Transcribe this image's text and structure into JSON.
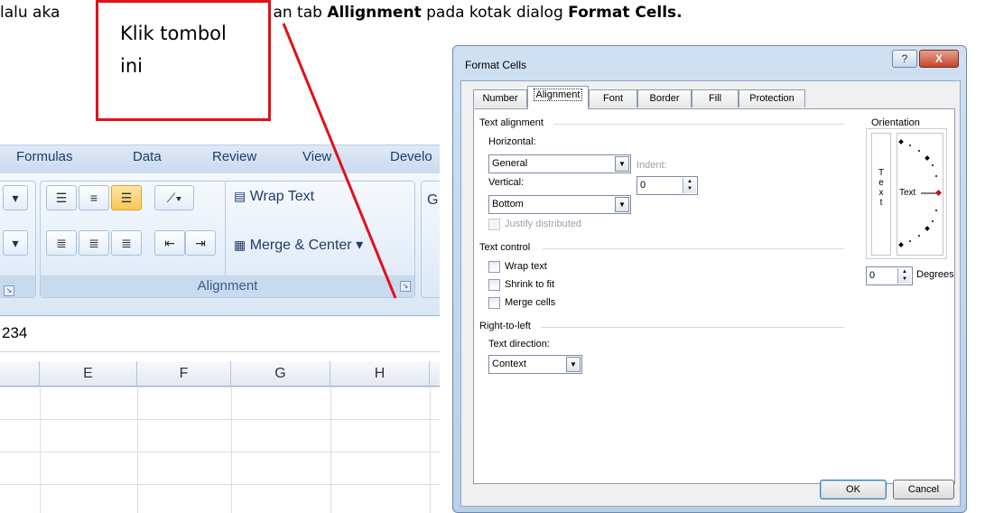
{
  "caption": {
    "prefix": "lalu aka",
    "middle": "an tab ",
    "bold1": "Allignment",
    "between": " pada kotak dialog ",
    "bold2": "Format Cells."
  },
  "callout": {
    "line1": "Klik tombol",
    "line2": "ini",
    "border_color": "#e0111a"
  },
  "excel": {
    "ribbon_tabs": [
      "Formulas",
      "Data",
      "Review",
      "View",
      "Develo"
    ],
    "wrap_text": "Wrap Text",
    "merge_center": "Merge & Center",
    "merge_dropdown": "▾",
    "group_label": "Alignment",
    "partial_g": "G",
    "formula_value": "234",
    "columns": [
      "E",
      "F",
      "G",
      "H"
    ]
  },
  "dialog": {
    "title": "Format Cells",
    "help": "?",
    "close": "X",
    "tabs": [
      "Number",
      "Alignment",
      "Font",
      "Border",
      "Fill",
      "Protection"
    ],
    "active_tab": "Alignment",
    "text_alignment": {
      "section": "Text alignment",
      "horizontal_label": "Horizontal:",
      "horizontal_value": "General",
      "vertical_label": "Vertical:",
      "vertical_value": "Bottom",
      "indent_label": "Indent:",
      "indent_value": "0",
      "justify_distributed": "Justify distributed"
    },
    "text_control": {
      "section": "Text control",
      "wrap_text": "Wrap text",
      "shrink_to_fit": "Shrink to fit",
      "merge_cells": "Merge cells"
    },
    "rtl": {
      "section": "Right-to-left",
      "direction_label": "Text direction:",
      "direction_value": "Context"
    },
    "orientation": {
      "section": "Orientation",
      "vertical_text": [
        "T",
        "e",
        "x",
        "t"
      ],
      "dial_text": "Text",
      "degrees_value": "0",
      "degrees_label": "Degrees"
    },
    "ok": "OK",
    "cancel": "Cancel"
  },
  "colors": {
    "arrow": "#e0111a",
    "accent": "#1e3d6b",
    "marker": "#c0141c"
  }
}
